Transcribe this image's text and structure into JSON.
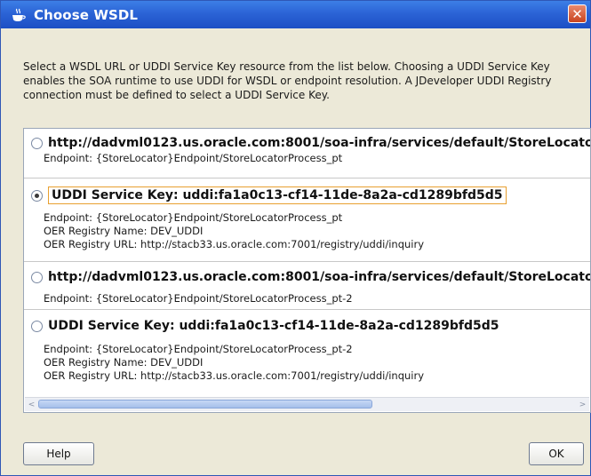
{
  "window": {
    "title": "Choose WSDL",
    "close_glyph": "✕"
  },
  "description": "Select a WSDL URL or UDDI Service Key resource from the list below.  Choosing  a UDDI Service Key enables the SOA runtime to use UDDI for WSDL or endpoint resolution. A JDeveloper UDDI Registry connection must be defined to select a UDDI Service Key.",
  "options": [
    {
      "title": "http://dadvml0123.us.oracle.com:8001/soa-infra/services/default/StoreLocato",
      "selected": false,
      "details": [
        "Endpoint: {StoreLocator}Endpoint/StoreLocatorProcess_pt"
      ]
    },
    {
      "title": "UDDI Service Key: uddi:fa1a0c13-cf14-11de-8a2a-cd1289bfd5d5",
      "selected": true,
      "details": [
        "Endpoint: {StoreLocator}Endpoint/StoreLocatorProcess_pt",
        "OER Registry Name: DEV_UDDI",
        "OER Registry URL: http://stacb33.us.oracle.com:7001/registry/uddi/inquiry"
      ]
    },
    {
      "title": "http://dadvml0123.us.oracle.com:8001/soa-infra/services/default/StoreLocato",
      "selected": false,
      "details": [
        "Endpoint: {StoreLocator}Endpoint/StoreLocatorProcess_pt-2"
      ]
    },
    {
      "title": "UDDI Service Key: uddi:fa1a0c13-cf14-11de-8a2a-cd1289bfd5d5",
      "selected": false,
      "details": [
        "Endpoint: {StoreLocator}Endpoint/StoreLocatorProcess_pt-2",
        "OER Registry Name: DEV_UDDI",
        "OER Registry URL: http://stacb33.us.oracle.com:7001/registry/uddi/inquiry"
      ]
    }
  ],
  "buttons": {
    "help": "Help",
    "ok": "OK"
  },
  "scroll": {
    "left_arrow": "<",
    "right_arrow": ">"
  },
  "icons": {
    "title": "coffee-cup-icon",
    "close": "close-icon"
  },
  "colors": {
    "titlebar": "#2b63d6",
    "dialog_bg": "#ece9d8",
    "focus_border": "#e8a030"
  }
}
